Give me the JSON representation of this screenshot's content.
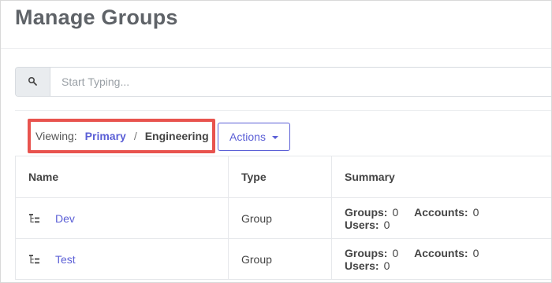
{
  "page": {
    "title": "Manage Groups"
  },
  "search": {
    "placeholder": "Start Typing...",
    "value": "",
    "icon": "search-icon"
  },
  "breadcrumb": {
    "label": "Viewing:",
    "link": "Primary",
    "separator": "/",
    "current": "Engineering",
    "highlight_color": "#e8534e"
  },
  "actions": {
    "label": "Actions"
  },
  "table": {
    "headers": [
      "Name",
      "Type",
      "Summary"
    ],
    "rows": [
      {
        "icon": "hierarchy-icon",
        "name": "Dev",
        "type": "Group",
        "summary": {
          "groups_label": "Groups:",
          "groups": "0",
          "accounts_label": "Accounts:",
          "accounts": "0",
          "users_label": "Users:",
          "users": "0"
        }
      },
      {
        "icon": "hierarchy-icon",
        "name": "Test",
        "type": "Group",
        "summary": {
          "groups_label": "Groups:",
          "groups": "0",
          "accounts_label": "Accounts:",
          "accounts": "0",
          "users_label": "Users:",
          "users": "0"
        }
      }
    ]
  },
  "colors": {
    "accent": "#5b5fd6",
    "title": "#5f6368"
  }
}
